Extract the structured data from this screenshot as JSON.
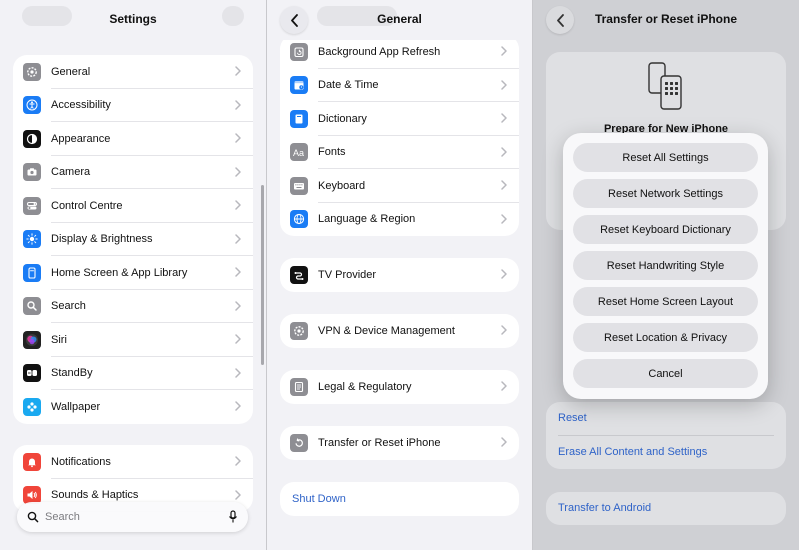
{
  "pane1": {
    "title": "Settings",
    "groups": [
      [
        {
          "label": "General",
          "icon": "gear-icon",
          "color": "#8e8e93",
          "name": "sidebar-item-general"
        },
        {
          "label": "Accessibility",
          "icon": "accessibility-icon",
          "color": "#1a7cf5",
          "name": "sidebar-item-accessibility"
        },
        {
          "label": "Appearance",
          "icon": "appearance-icon",
          "color": "#111111",
          "name": "sidebar-item-appearance"
        },
        {
          "label": "Camera",
          "icon": "camera-icon",
          "color": "#8e8e93",
          "name": "sidebar-item-camera"
        },
        {
          "label": "Control Centre",
          "icon": "toggles-icon",
          "color": "#8e8e93",
          "name": "sidebar-item-control-centre"
        },
        {
          "label": "Display & Brightness",
          "icon": "sun-icon",
          "color": "#1a7cf5",
          "name": "sidebar-item-display-brightness"
        },
        {
          "label": "Home Screen & App Library",
          "icon": "home-screen-icon",
          "color": "#1a7cf5",
          "name": "sidebar-item-home-screen"
        },
        {
          "label": "Search",
          "icon": "search-icon",
          "color": "#8e8e93",
          "name": "sidebar-item-search"
        },
        {
          "label": "Siri",
          "icon": "siri-icon",
          "color": "#222222",
          "name": "sidebar-item-siri"
        },
        {
          "label": "StandBy",
          "icon": "standby-icon",
          "color": "#111111",
          "name": "sidebar-item-standby"
        },
        {
          "label": "Wallpaper",
          "icon": "wallpaper-icon",
          "color": "#1aa9f0",
          "name": "sidebar-item-wallpaper"
        }
      ],
      [
        {
          "label": "Notifications",
          "icon": "bell-icon",
          "color": "#f0453a",
          "name": "sidebar-item-notifications"
        },
        {
          "label": "Sounds & Haptics",
          "icon": "speaker-icon",
          "color": "#f0453a",
          "name": "sidebar-item-sounds-haptics"
        }
      ]
    ],
    "search_placeholder": "Search"
  },
  "pane2": {
    "title": "General",
    "group1": [
      {
        "label": "Background App Refresh",
        "icon": "refresh-icon",
        "color": "#8e8e93",
        "name": "general-item-background-app-refresh"
      },
      {
        "label": "Date & Time",
        "icon": "calendar-icon",
        "color": "#1a7cf5",
        "name": "general-item-date-time"
      },
      {
        "label": "Dictionary",
        "icon": "book-icon",
        "color": "#1a7cf5",
        "name": "general-item-dictionary"
      },
      {
        "label": "Fonts",
        "icon": "fonts-icon",
        "color": "#8e8e93",
        "name": "general-item-fonts"
      },
      {
        "label": "Keyboard",
        "icon": "keyboard-icon",
        "color": "#8e8e93",
        "name": "general-item-keyboard"
      },
      {
        "label": "Language & Region",
        "icon": "globe-icon",
        "color": "#1a7cf5",
        "name": "general-item-language-region"
      }
    ],
    "tv_provider": {
      "label": "TV Provider",
      "icon": "tv-provider-icon",
      "color": "#111111"
    },
    "vpn": {
      "label": "VPN & Device Management",
      "icon": "vpn-gear-icon",
      "color": "#8e8e93"
    },
    "legal": {
      "label": "Legal & Regulatory",
      "icon": "document-icon",
      "color": "#8e8e93"
    },
    "transfer": {
      "label": "Transfer or Reset iPhone",
      "icon": "reset-icon",
      "color": "#8e8e93"
    },
    "shut_down": "Shut Down"
  },
  "pane3": {
    "title": "Transfer or Reset iPhone",
    "prepare_label": "Prepare for New iPhone",
    "reset_label": "Reset",
    "erase_label": "Erase All Content and Settings",
    "transfer_android": "Transfer to Android",
    "sheet_options": [
      {
        "label": "Reset All Settings",
        "name": "reset-all-settings-button"
      },
      {
        "label": "Reset Network Settings",
        "name": "reset-network-settings-button"
      },
      {
        "label": "Reset Keyboard Dictionary",
        "name": "reset-keyboard-dictionary-button"
      },
      {
        "label": "Reset Handwriting Style",
        "name": "reset-handwriting-style-button"
      },
      {
        "label": "Reset Home Screen Layout",
        "name": "reset-home-screen-layout-button"
      },
      {
        "label": "Reset Location & Privacy",
        "name": "reset-location-privacy-button"
      },
      {
        "label": "Cancel",
        "name": "cancel-button"
      }
    ]
  },
  "colors": {
    "accent_blue": "#2f63c8",
    "background": "#f2f2f6",
    "dimmed_background": "#cfd0d4"
  }
}
